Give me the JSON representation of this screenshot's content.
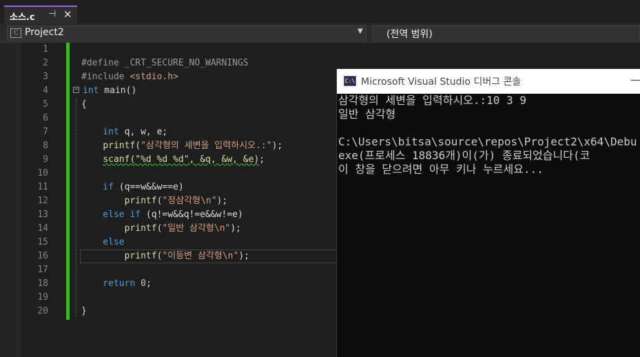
{
  "tab": {
    "name": "소스.c",
    "pin_icon": "pin-icon",
    "close_icon": "close-icon"
  },
  "navbar": {
    "project": "Project2",
    "scope": "(전역 범위)"
  },
  "editor": {
    "line_numbers": [
      "1",
      "2",
      "3",
      "4",
      "5",
      "6",
      "7",
      "8",
      "9",
      "10",
      "11",
      "12",
      "13",
      "14",
      "15",
      "16",
      "17",
      "18",
      "19",
      "20"
    ],
    "code": {
      "l2": "#define _CRT_SECURE_NO_WARNINGS",
      "l3a": "#include ",
      "l3b": "<stdio.h>",
      "l4a": "int",
      "l4b": " main()",
      "l5": "{",
      "l7a": "    int",
      "l7b": " q, w, e;",
      "l8a": "    ",
      "l8b": "printf",
      "l8c": "(",
      "l8d": "\"삼각형의 세변을 입력하시오.:\"",
      "l8e": ");",
      "l9a": "    ",
      "l9b": "scanf(\"%d %d %d\", &q, &w, &e)",
      "l9c": ";",
      "l11a": "    if",
      "l11b": " (q==w&&w==e)",
      "l12a": "        ",
      "l12b": "printf",
      "l12c": "(",
      "l12d": "\"정삼각형\\n\"",
      "l12e": ");",
      "l13a": "    else if",
      "l13b": " (q!=w&&q!=e&&w!=e)",
      "l14a": "        ",
      "l14b": "printf",
      "l14c": "(",
      "l14d": "\"일반 삼각형\\n\"",
      "l14e": ");",
      "l15": "    else",
      "l16a": "        ",
      "l16b": "printf",
      "l16c": "(",
      "l16d": "\"이등변 삼각형\\n\"",
      "l16e": ");",
      "l18a": "    return",
      "l18b": " ",
      "l18c": "0",
      "l18d": ";",
      "l20": "}"
    }
  },
  "console": {
    "title": "Microsoft Visual Studio 디버그 콘솔",
    "minimize": "—",
    "lines": [
      "삼각형의 세변을 입력하시오.:10 3 9",
      "일반 삼각형",
      "",
      "C:\\Users\\bitsa\\source\\repos\\Project2\\x64\\Debu",
      "exe(프로세스 18836개)이(가) 종료되었습니다(코",
      "이 창을 닫으려면 아무 키나 누르세요..."
    ]
  },
  "colors": {
    "accent": "#9b5de5",
    "change_bar": "#43b02a",
    "keyword": "#569cd6",
    "string": "#d69d85"
  }
}
